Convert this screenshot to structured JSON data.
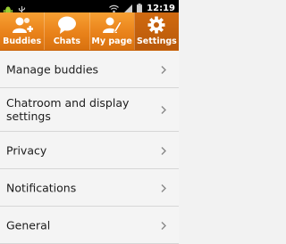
{
  "status_bar": {
    "time": "12:19",
    "icons": [
      "android-icon",
      "usb-icon",
      "wifi-icon",
      "signal-icon",
      "battery-icon"
    ]
  },
  "tabs": [
    {
      "label": "Buddies",
      "icon": "buddies-icon",
      "selected": false
    },
    {
      "label": "Chats",
      "icon": "chat-bubble-icon",
      "selected": false
    },
    {
      "label": "My page",
      "icon": "my-page-icon",
      "selected": false
    },
    {
      "label": "Settings",
      "icon": "gear-icon",
      "selected": true
    }
  ],
  "menu": {
    "items": [
      {
        "label": "Manage buddies"
      },
      {
        "label": "Chatroom and display settings"
      },
      {
        "label": "Privacy"
      },
      {
        "label": "Notifications"
      },
      {
        "label": "General"
      }
    ]
  },
  "colors": {
    "tab_bar": "#e9821a",
    "tab_selected": "#b9590a",
    "background": "#f2f2f2"
  }
}
